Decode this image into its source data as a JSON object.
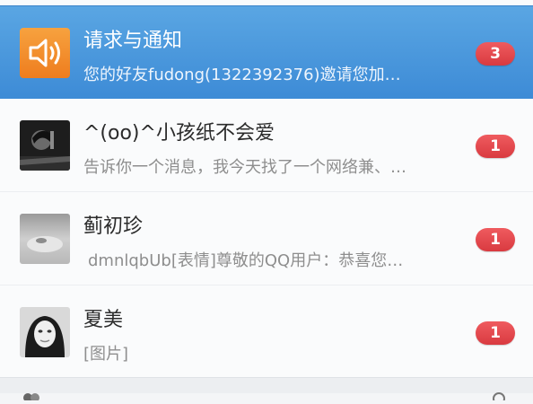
{
  "conversations": [
    {
      "name": "请求与通知",
      "preview": "您的好友fudong(1322392376)邀请您加…",
      "unread": "3",
      "avatar_icon": "speaker-icon",
      "selected": true
    },
    {
      "name": "^(oo)^小孩纸不会爱",
      "preview": "告诉你一个消息，我今天找了一个网络兼、…",
      "unread": "1",
      "avatar_icon": "user-avatar"
    },
    {
      "name": "蓟初珍",
      "preview": "dmnlqbUb[表情]尊敬的QQ用户：恭喜您…",
      "unread": "1",
      "avatar_icon": "user-avatar"
    },
    {
      "name": "夏美",
      "preview": "[图片]",
      "unread": "1",
      "avatar_icon": "user-avatar"
    }
  ],
  "colors": {
    "selected_bg": "#4a97dc",
    "badge": "#e0464b",
    "notice_icon": "#f2892b"
  }
}
